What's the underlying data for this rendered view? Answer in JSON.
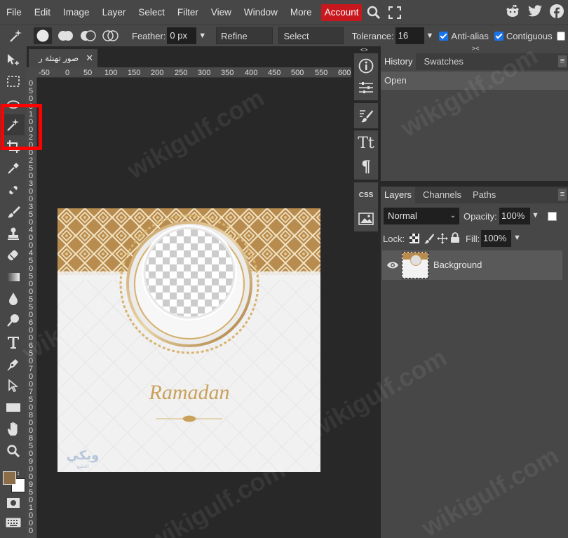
{
  "menu": {
    "items": [
      "File",
      "Edit",
      "Image",
      "Layer",
      "Select",
      "Filter",
      "View",
      "Window",
      "More"
    ],
    "account": "Account"
  },
  "options": {
    "feather_label": "Feather:",
    "feather_value": "0 px",
    "refine_edge": "Refine Edge",
    "select_subject": "Select Subject",
    "tolerance_label": "Tolerance:",
    "tolerance_value": "16",
    "antialias": "Anti-alias",
    "contiguous": "Contiguous"
  },
  "document": {
    "tab_title": "صور تهنئة ر",
    "ruler_h": [
      "-50",
      "0",
      "50",
      "100",
      "150",
      "200",
      "250",
      "300",
      "350",
      "400",
      "450",
      "500",
      "550",
      "600"
    ],
    "ruler_v": [
      "0",
      "5",
      "0",
      "0",
      "1",
      "0",
      "0",
      "2",
      "0",
      "0",
      "2",
      "5",
      "0",
      "3",
      "0",
      "0",
      "3",
      "5",
      "0",
      "4",
      "0",
      "0",
      "4",
      "5",
      "0",
      "5",
      "0",
      "0",
      "5",
      "5",
      "0",
      "6",
      "0",
      "0",
      "6",
      "5",
      "0",
      "7",
      "0",
      "0",
      "7",
      "5",
      "0",
      "8",
      "0",
      "0",
      "8",
      "5",
      "0",
      "9",
      "0",
      "0",
      "9",
      "5",
      "0",
      "1",
      "0",
      "0",
      "0"
    ],
    "canvas_text": "Ramadan",
    "canvas_logo": "ويكي",
    "canvas_logo_sub": "الخليج"
  },
  "history": {
    "tabs": [
      "History",
      "Swatches"
    ],
    "items": [
      "Open"
    ]
  },
  "layers": {
    "tabs": [
      "Layers",
      "Channels",
      "Paths"
    ],
    "blend_mode": "Normal",
    "opacity_label": "Opacity:",
    "opacity_value": "100%",
    "lock_label": "Lock:",
    "fill_label": "Fill:",
    "fill_value": "100%",
    "layer_name": "Background"
  },
  "side_labels": {
    "css": "CSS"
  },
  "watermark": "wikigulf.com",
  "colors": {
    "foreground": "#8b6d47",
    "background": "#ffffff",
    "account": "#c8181e",
    "highlight": "#ff0000"
  }
}
